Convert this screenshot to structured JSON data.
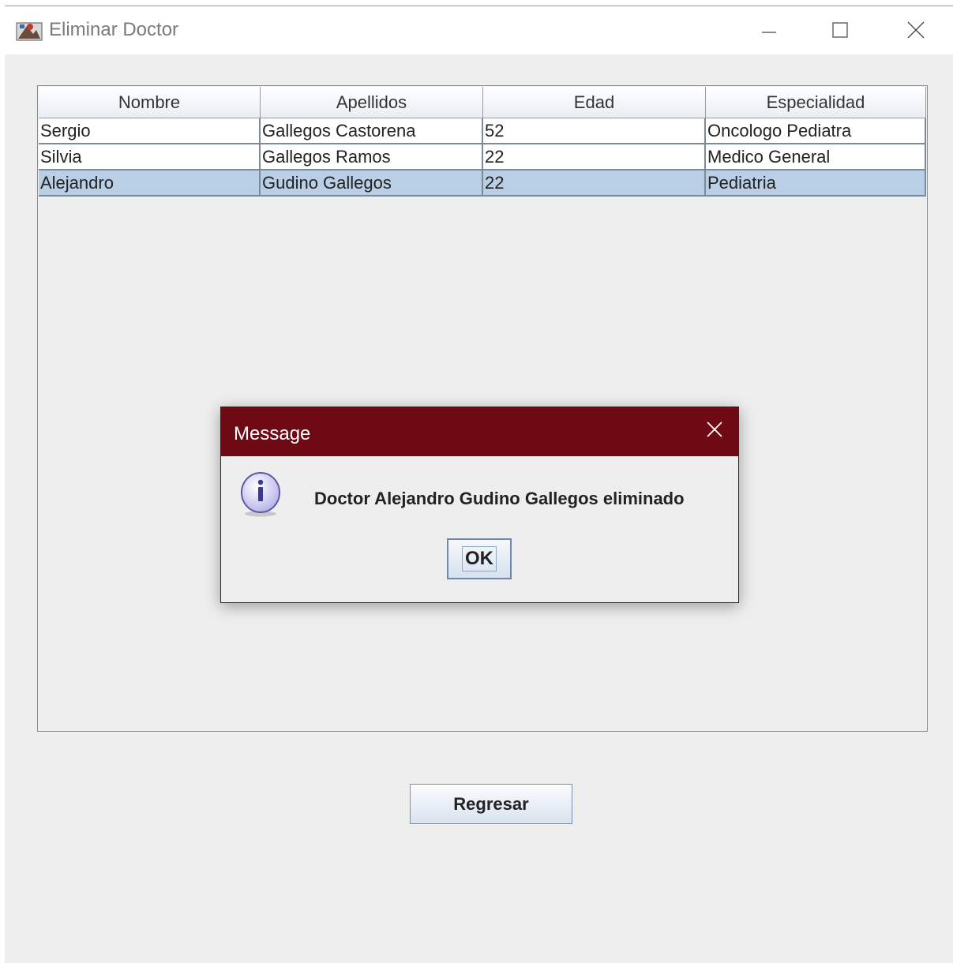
{
  "window": {
    "title": "Eliminar Doctor",
    "icons": [
      "app-icon",
      "minimize-icon",
      "maximize-icon",
      "close-icon"
    ]
  },
  "table": {
    "columns": [
      "Nombre",
      "Apellidos",
      "Edad",
      "Especialidad"
    ],
    "rows": [
      [
        "Sergio",
        "Gallegos Castorena",
        "52",
        "Oncologo Pediatra"
      ],
      [
        "Silvia",
        "Gallegos Ramos",
        "22",
        "Medico General"
      ],
      [
        "Alejandro",
        "Gudino Gallegos",
        "22",
        "Pediatria"
      ]
    ],
    "selected_row": 2
  },
  "dialog": {
    "title": "Message",
    "message": "Doctor Alejandro Gudino Gallegos eliminado",
    "ok_label": "OK",
    "icon": "info-icon"
  },
  "actions": {
    "back_label": "Regresar"
  },
  "colors": {
    "dialog_titlebar": "#6d0a14",
    "selection": "#b8cfe5",
    "client_bg": "#eeeeee"
  }
}
